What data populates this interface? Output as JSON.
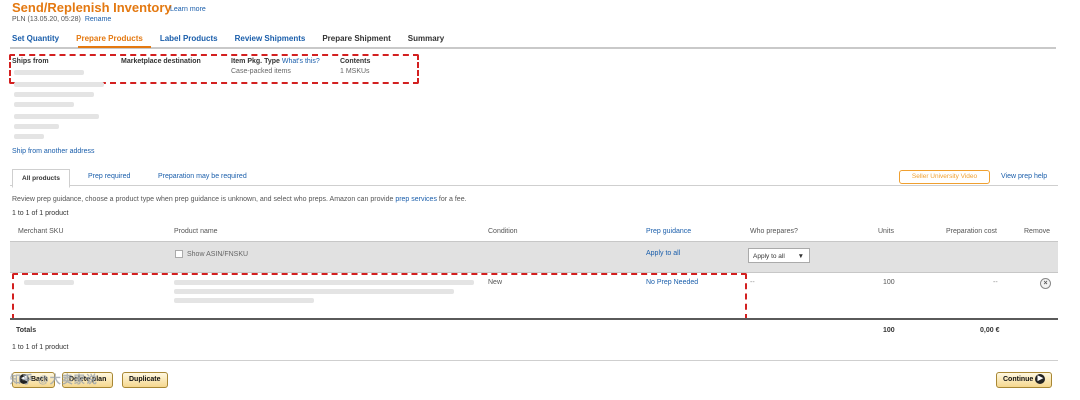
{
  "header": {
    "title": "Send/Replenish Inventory",
    "learn_more": "Learn more",
    "plan_name": "PLN (13.05.20, 05:28)",
    "rename": "Rename"
  },
  "steps": [
    "Set Quantity",
    "Prepare Products",
    "Label Products",
    "Review Shipments",
    "Prepare Shipment",
    "Summary"
  ],
  "ship_info": {
    "ships_from_label": "Ships from",
    "marketplace_label": "Marketplace destination",
    "pkg_type_label": "Item Pkg. Type",
    "whats_this": "What's this?",
    "pkg_type_value": "Case-packed items",
    "contents_label": "Contents",
    "contents_value": "1 MSKUs",
    "ship_from_another": "Ship from another address"
  },
  "tabs": {
    "all": "All products",
    "prep_required": "Prep required",
    "prep_may": "Preparation may be required",
    "seller_video": "Seller University Video",
    "view_prep_help": "View prep help"
  },
  "guidance": {
    "text": "Review prep guidance, choose a product type when prep guidance is unknown, and select who preps. Amazon can provide",
    "link": "prep services",
    "suffix": "for a fee."
  },
  "count_top": "1 to 1 of 1 product",
  "count_bottom": "1 to 1 of 1 product",
  "columns": {
    "sku": "Merchant SKU",
    "name": "Product name",
    "condition": "Condition",
    "prep_guidance": "Prep guidance",
    "who_prepares": "Who prepares?",
    "units": "Units",
    "prep_cost": "Preparation cost",
    "remove": "Remove"
  },
  "bulk_row": {
    "show_asin": "Show ASIN/FNSKU",
    "apply_to_all_link": "Apply to all",
    "select_value": "Apply to all",
    "select_arrow": "▼"
  },
  "product_row": {
    "condition": "New",
    "prep_guidance": "No Prep Needed",
    "who_prepares": "--",
    "units": "100",
    "prep_cost": "--",
    "remove_icon": "×"
  },
  "totals": {
    "label": "Totals",
    "units": "100",
    "cost": "0,00 €"
  },
  "buttons": {
    "back": "Back",
    "delete_plan": "Delete plan",
    "duplicate": "Duplicate",
    "continue": "Continue",
    "back_arrow": "◀",
    "continue_arrow": "▶"
  },
  "watermark": "知乎 @大卖家说",
  "colors": {
    "accent_orange": "#e47911",
    "link_blue": "#1a5eab",
    "highlight_red": "#d32020"
  }
}
